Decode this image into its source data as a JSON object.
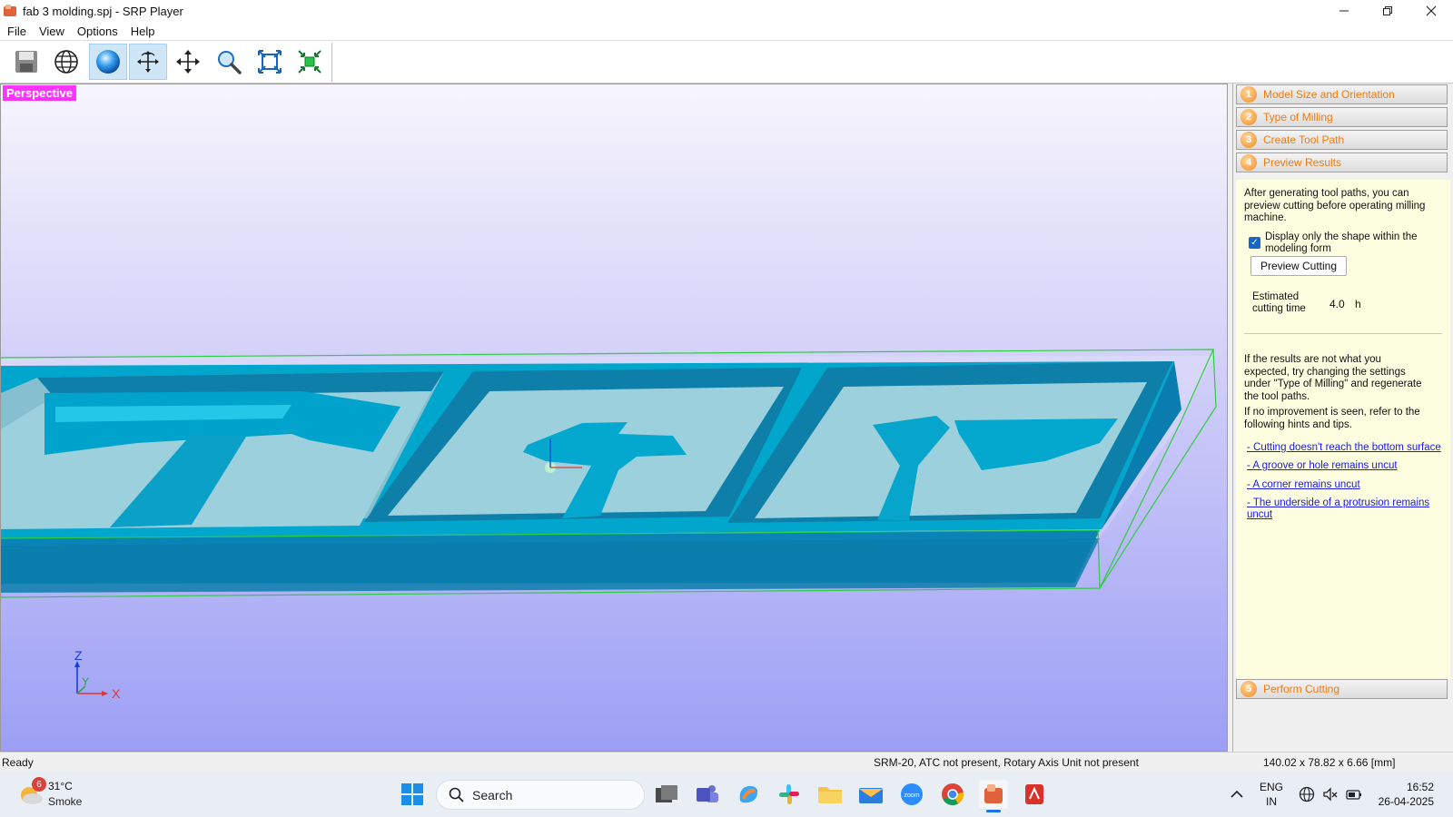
{
  "window": {
    "title": "fab 3 molding.spj - SRP Player",
    "controls": [
      "minimize",
      "maximize",
      "close"
    ]
  },
  "menu": [
    "File",
    "View",
    "Options",
    "Help"
  ],
  "toolbar": {
    "buttons": [
      "save-icon",
      "globe-icon",
      "sphere-icon",
      "rotate-icon",
      "move-icon",
      "zoom-icon",
      "fit-icon",
      "reset-view-icon"
    ],
    "active": [
      "sphere-icon",
      "rotate-icon"
    ]
  },
  "viewport": {
    "label": "Perspective",
    "axes": {
      "z": "Z",
      "y": "Y",
      "x": "X"
    },
    "colors": {
      "model": "#00a5c8",
      "bbox": "#2ecc40",
      "label_bg": "#ff33ff"
    }
  },
  "panel": {
    "steps": [
      {
        "num": "1",
        "label": "Model Size and Orientation"
      },
      {
        "num": "2",
        "label": "Type of Milling"
      },
      {
        "num": "3",
        "label": "Create Tool Path"
      },
      {
        "num": "4",
        "label": "Preview Results"
      }
    ],
    "step5": {
      "num": "5",
      "label": "Perform Cutting"
    },
    "intro": [
      "After generating tool paths, you can",
      "preview cutting before operating milling",
      "machine."
    ],
    "checkbox": {
      "checked": true,
      "label": [
        "Display only the shape within the",
        "modeling form"
      ]
    },
    "preview_button": "Preview Cutting",
    "estimate": {
      "label": [
        "Estimated",
        "cutting time"
      ],
      "value": "4.0",
      "unit": "h"
    },
    "results_text": [
      "If the results are not what you",
      "expected, try changing the settings",
      "under \"Type of Milling\" and regenerate",
      "the tool paths."
    ],
    "noimprove_text": [
      "If no improvement is seen, refer to the",
      "following hints and tips."
    ],
    "hints": [
      [
        "- Cutting doesn't reach the bottom surface"
      ],
      [
        "- A groove or hole remains uncut"
      ],
      [
        "- A corner remains uncut"
      ],
      [
        "- The underside of a protrusion remains",
        "uncut"
      ]
    ]
  },
  "status": {
    "left": "Ready",
    "machine": "SRM-20, ATC not present, Rotary Axis Unit not present",
    "size": "140.02 x  78.82 x   6.66 [mm]"
  },
  "taskbar": {
    "weather": {
      "temp": "31°C",
      "desc": "Smoke",
      "badge": "6"
    },
    "search": "Search",
    "lang": [
      "ENG",
      "IN"
    ],
    "time": "16:52",
    "date": "26-04-2025"
  }
}
